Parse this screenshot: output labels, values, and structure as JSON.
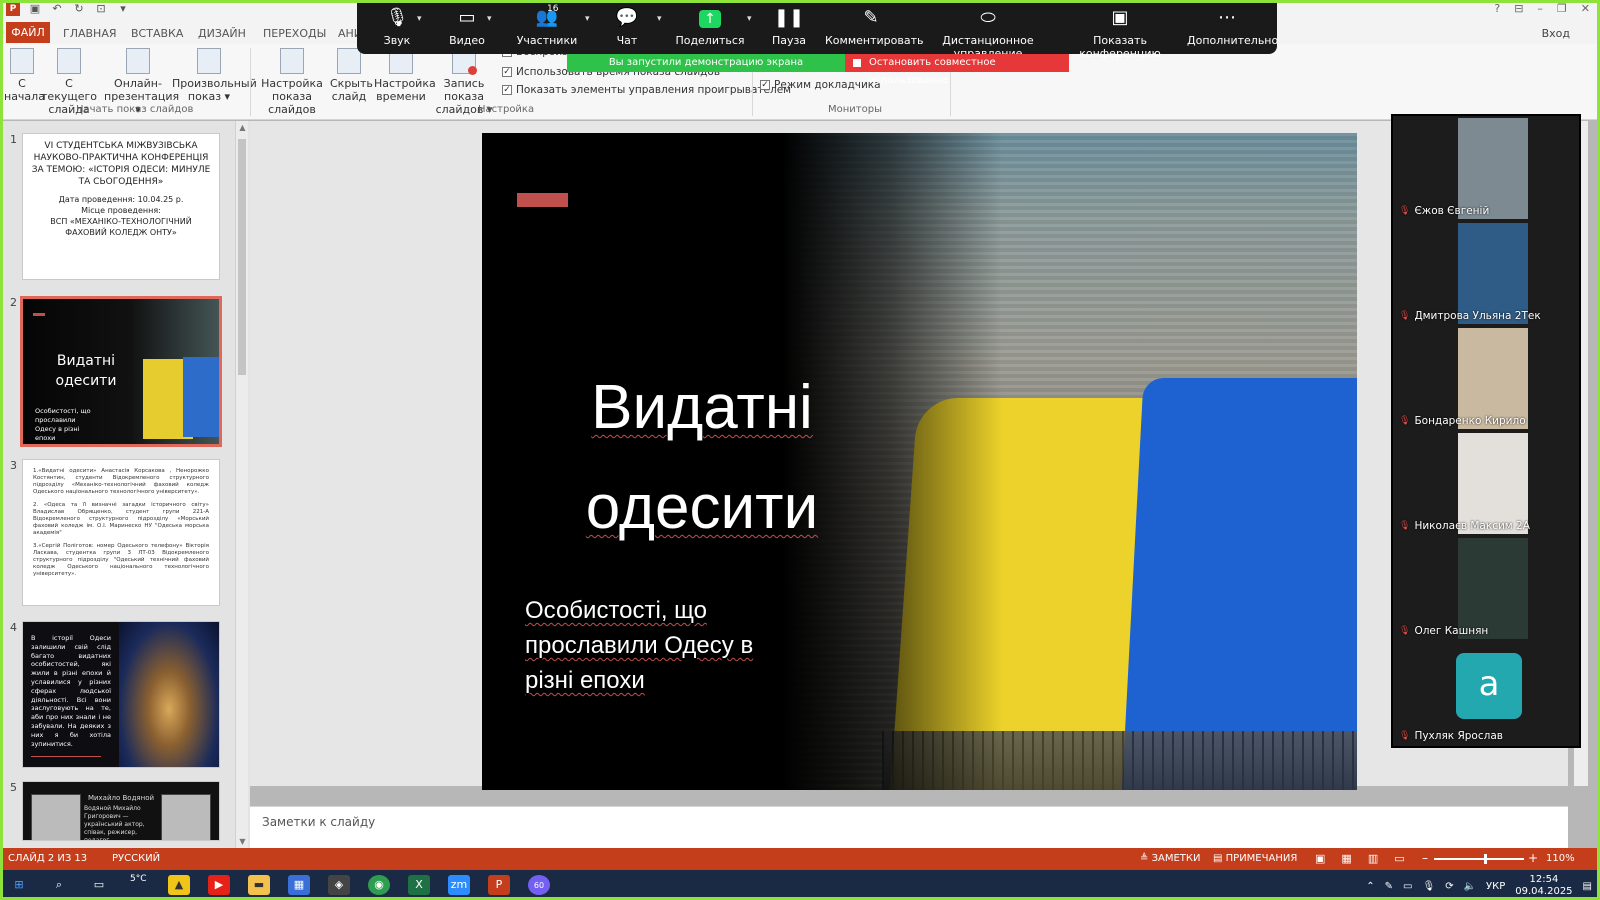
{
  "qat": {
    "app_icon": "P"
  },
  "window": {
    "sign_in": "Вход"
  },
  "ribbon_tabs": [
    "ФАЙЛ",
    "ГЛАВНАЯ",
    "ВСТАВКА",
    "ДИЗАЙН",
    "ПЕРЕХОДЫ",
    "АНИ"
  ],
  "ribbon": {
    "start_group": {
      "label": "Начать показ слайдов",
      "from_start": [
        "С",
        "начала"
      ],
      "from_current": [
        "С текущего",
        "слайда"
      ],
      "online": [
        "Онлайн-",
        "презентация ▾"
      ],
      "custom": [
        "Произвольный",
        "показ ▾"
      ]
    },
    "setup_group": {
      "label": "Настройка",
      "setup_show": [
        "Настройка",
        "показа слайдов"
      ],
      "hide_slide": [
        "Скрыть",
        "слайд"
      ],
      "rehearse": [
        "Настройка",
        "времени"
      ],
      "record": [
        "Запись показа",
        "слайдов ▾"
      ],
      "checkboxes": [
        "Воспроизв...",
        "Использовать время показа слайдов",
        "Показать элементы управления проигрывателем"
      ]
    },
    "monitors_group": {
      "label": "Мониторы",
      "presenter_view": "Режим докладчика"
    }
  },
  "zoom": {
    "items": [
      {
        "label": "Звук",
        "icon": "microphone-icon"
      },
      {
        "label": "Видео",
        "icon": "camera-icon"
      },
      {
        "label": "Участники",
        "icon": "participants-icon",
        "count": "16"
      },
      {
        "label": "Чат",
        "icon": "chat-icon"
      },
      {
        "label": "Поделиться",
        "icon": "share-screen-icon"
      },
      {
        "label": "Пауза",
        "icon": "pause-icon"
      },
      {
        "label": "Комментировать",
        "icon": "pencil-icon"
      },
      {
        "label": "Дистанционное управление",
        "icon": "mouse-icon"
      },
      {
        "label": "Показать конференцию",
        "icon": "meeting-window-icon"
      },
      {
        "label": "Дополнительно",
        "icon": "more-icon"
      }
    ],
    "sharing_banner": "Вы запустили демонстрацию экрана",
    "stop_banner": "Остановить совместное использование"
  },
  "thumbnails": {
    "numbers": [
      "1",
      "2",
      "3",
      "4",
      "5"
    ],
    "slide1": {
      "title": "VI СТУДЕНТСЬКА МІЖВУЗІВСЬКА НАУКОВО-ПРАКТИЧНА КОНФЕРЕНЦІЯ ЗА ТЕМОЮ: «ІСТОРІЯ ОДЕСИ: МИНУЛЕ ТА СЬОГОДЕННЯ»",
      "date": "Дата проведення: 10.04.25 р.",
      "place_label": "Місце проведення:",
      "place": "ВСП «МЕХАНІКО-ТЕХНОЛОГІЧНИЙ ФАХОВИЙ КОЛЕДЖ ОНТУ»"
    },
    "slide2": {
      "title": "Видатні одесити",
      "sub": "Особистості, що прославили Одесу в різні епохи"
    },
    "slide3": {
      "p1": "1.«Видатні одесити» Анастасія Корсакова , Ненорожко Костянтин, студенти Відокремленого структурного підрозділу «Механіко-технологічний фаховий коледж Одеського національного технологічного університету».",
      "p2": "2. «Одеса та її визначні загадки історичного світу» Владислав Обрященко, студент групи 221-А Відокремленого структурного підрозділу «Морський фаховий коледж ім. О.І. Маринеско НУ \"Одеська морська академія\"",
      "p3": "3.«Сергій Поліготов: номер Одеського телефону» Вікторія Ласкава, студентка групи 3 ЛТ-03 Відокремленого структурного підрозділу \"Одеський технічний фаховий коледж Одеського національного технологічного університету»."
    },
    "slide4": {
      "text": "В історії Одеси залишили свій слід багато видатних особистостей, які жили в різні епохи й уславилися у різних сферах людської діяльності. Всі вони заслуговують на те, аби про них знали і не забували. На деяких з них я би хотіла зупинитися."
    },
    "slide5": {
      "name": "Михайло Водяной",
      "text": "Водяной Михайло Григорович — український актор, співак, режисер, педагог."
    }
  },
  "slide": {
    "title_lines": [
      "Видатні",
      "одесити"
    ],
    "subtitle_lines": [
      "Особистості, що",
      "прославили Одесу в",
      "різні епохи"
    ]
  },
  "notes": {
    "placeholder": "Заметки к слайду"
  },
  "gallery": [
    {
      "name": "Єжов Євгеній",
      "type": "video"
    },
    {
      "name": "Дмитрова Ульяна 2Тек",
      "type": "video"
    },
    {
      "name": "Бондаренко Кирило",
      "type": "video"
    },
    {
      "name": "Николаєв Максим 2А",
      "type": "video"
    },
    {
      "name": "Олег Кашнян",
      "type": "video"
    },
    {
      "name": "Пухляк Ярослав",
      "type": "avatar",
      "initial": "a"
    }
  ],
  "status": {
    "slide_count": "СЛАЙД 2 ИЗ 13",
    "language": "РУССКИЙ",
    "notes": "ЗАМЕТКИ",
    "comments": "ПРИМЕЧАНИЯ",
    "zoom": "110%"
  },
  "taskbar": {
    "weather": "5°C",
    "lang": "УКР",
    "time": "12:54",
    "date": "09.04.2025",
    "viber_badge": "60"
  },
  "colors": {
    "ppt_red": "#c43e1c",
    "zoom_green": "#2ec24a",
    "zoom_stop_red": "#e63838",
    "frame_green": "#8ee33b"
  }
}
